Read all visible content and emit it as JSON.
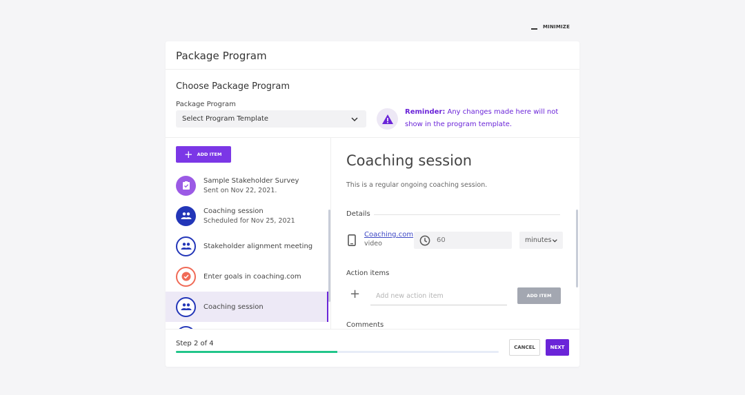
{
  "topbar": {
    "minimize_label": "MINIMIZE"
  },
  "modal": {
    "title": "Package Program"
  },
  "choose": {
    "heading": "Choose Package Program",
    "field_label": "Package Program",
    "select_value": "Select Program Template",
    "reminder_bold": "Reminder:",
    "reminder_text": " Any changes made here will not show in the program template."
  },
  "sidebar": {
    "add_item_label": "ADD ITEM",
    "items": [
      {
        "title": "Sample Stakeholder Survey",
        "subtitle": "Sent on Nov 22, 2021.",
        "icon": "survey-check-icon"
      },
      {
        "title": "Coaching session",
        "subtitle": "Scheduled for Nov 25, 2021",
        "icon": "group-icon"
      },
      {
        "title": "Stakeholder alignment meeting",
        "subtitle": "",
        "icon": "group-icon"
      },
      {
        "title": "Enter goals in coaching.com",
        "subtitle": "",
        "icon": "goal-check-icon"
      },
      {
        "title": "Coaching session",
        "subtitle": "",
        "icon": "group-icon",
        "selected": true
      }
    ]
  },
  "detail": {
    "title": "Coaching session",
    "description": "This is a regular ongoing coaching session.",
    "details_label": "Details",
    "vendor_link": "Coaching.com",
    "vendor_sub": "video",
    "duration_value": "60",
    "duration_unit": "minutes",
    "action_items_label": "Action items",
    "action_placeholder": "Add new action item",
    "action_add_label": "ADD ITEM",
    "comments_label": "Comments"
  },
  "footer": {
    "step_text": "Step 2 of 4",
    "progress_fraction": 0.5,
    "cancel_label": "CANCEL",
    "next_label": "NEXT"
  },
  "colors": {
    "accent": "#6a24d8",
    "accent_button": "#7b37e6",
    "progress": "#21c58a",
    "navy": "#2336b8",
    "coral": "#f06a56"
  }
}
